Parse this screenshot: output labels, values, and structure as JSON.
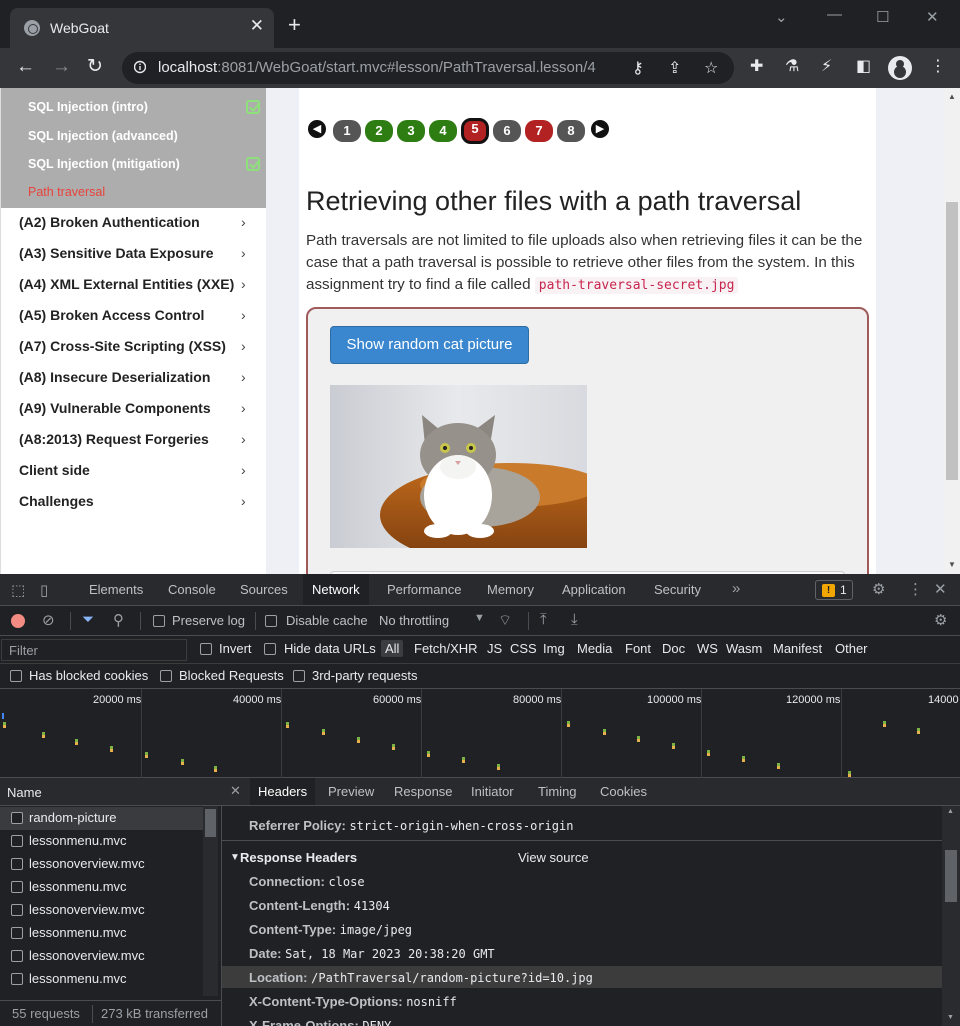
{
  "browser": {
    "tab_title": "WebGoat",
    "url_host": "localhost",
    "url_rest": ":8081/WebGoat/start.mvc#lesson/PathTraversal.lesson/4"
  },
  "sidebar": {
    "subitems": [
      {
        "label": "SQL Injection (intro)",
        "completed": true
      },
      {
        "label": "SQL Injection (advanced)",
        "completed": false
      },
      {
        "label": "SQL Injection (mitigation)",
        "completed": true
      },
      {
        "label": "Path traversal",
        "active": true
      }
    ],
    "categories": [
      "(A2) Broken Authentication",
      "(A3) Sensitive Data Exposure",
      "(A4) XML External Entities (XXE)",
      "(A5) Broken Access Control",
      "(A7) Cross-Site Scripting (XSS)",
      "(A8) Insecure Deserialization",
      "(A9) Vulnerable Components",
      "(A8:2013) Request Forgeries",
      "Client side",
      "Challenges"
    ]
  },
  "lesson": {
    "pages": [
      {
        "n": "1",
        "state": "grey"
      },
      {
        "n": "2",
        "state": "green"
      },
      {
        "n": "3",
        "state": "green"
      },
      {
        "n": "4",
        "state": "green"
      },
      {
        "n": "5",
        "state": "current"
      },
      {
        "n": "6",
        "state": "grey"
      },
      {
        "n": "7",
        "state": "red"
      },
      {
        "n": "8",
        "state": "grey"
      }
    ],
    "title": "Retrieving other files with a path traversal",
    "paragraph": "Path traversals are not limited to file uploads also when retrieving files it can be the case that a path traversal is possible to retrieve other files from the system. In this assignment try to find a file called",
    "secret_file": "path-traversal-secret.jpg",
    "button_label": "Show random cat picture"
  },
  "devtools": {
    "tabs": [
      "Elements",
      "Console",
      "Sources",
      "Network",
      "Performance",
      "Memory",
      "Application",
      "Security"
    ],
    "active_tab": "Network",
    "warning_count": "1",
    "preserve_log": "Preserve log",
    "disable_cache": "Disable cache",
    "throttling": "No throttling",
    "filter_placeholder": "Filter",
    "invert": "Invert",
    "hide_data_urls": "Hide data URLs",
    "types": [
      "All",
      "Fetch/XHR",
      "JS",
      "CSS",
      "Img",
      "Media",
      "Font",
      "Doc",
      "WS",
      "Wasm",
      "Manifest",
      "Other"
    ],
    "blocked": [
      "Has blocked cookies",
      "Blocked Requests",
      "3rd-party requests"
    ],
    "timeline_labels": [
      "20000 ms",
      "40000 ms",
      "60000 ms",
      "80000 ms",
      "100000 ms",
      "120000 ms",
      "14000"
    ],
    "name_header": "Name",
    "requests": [
      "random-picture",
      "lessonmenu.mvc",
      "lessonoverview.mvc",
      "lessonmenu.mvc",
      "lessonoverview.mvc",
      "lessonmenu.mvc",
      "lessonoverview.mvc",
      "lessonmenu.mvc"
    ],
    "status_requests": "55 requests",
    "status_transferred": "273 kB transferred",
    "detail_tabs": [
      "Headers",
      "Preview",
      "Response",
      "Initiator",
      "Timing",
      "Cookies"
    ],
    "referrer_key": "Referrer Policy:",
    "referrer_val": "strict-origin-when-cross-origin",
    "response_headers_title": "Response Headers",
    "view_source": "View source",
    "headers": [
      {
        "k": "Connection:",
        "v": "close"
      },
      {
        "k": "Content-Length:",
        "v": "41304"
      },
      {
        "k": "Content-Type:",
        "v": "image/jpeg"
      },
      {
        "k": "Date:",
        "v": "Sat, 18 Mar 2023 20:38:20 GMT"
      },
      {
        "k": "Location:",
        "v": "/PathTraversal/random-picture?id=10.jpg"
      },
      {
        "k": "X-Content-Type-Options:",
        "v": "nosniff"
      },
      {
        "k": "X-Frame-Options:",
        "v": "DENY"
      }
    ]
  }
}
